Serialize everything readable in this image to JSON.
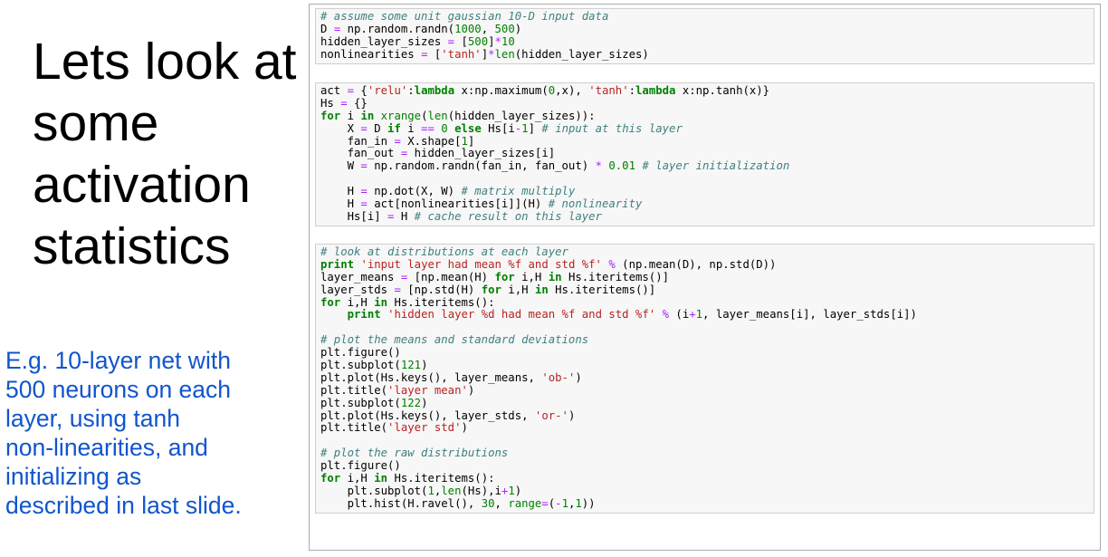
{
  "slide": {
    "title_lines": [
      "Lets look at",
      "some",
      "activation",
      "statistics"
    ],
    "caption_lines": [
      "E.g. 10-layer net with",
      "500 neurons on each",
      "layer, using tanh",
      "non-linearities, and",
      "initializing as",
      "described in last slide."
    ]
  },
  "cells": [
    {
      "lines": [
        "# assume some unit gaussian 10-D input data",
        "D = np.random.randn(1000, 500)",
        "hidden_layer_sizes = [500]*10",
        "nonlinearities = ['tanh']*len(hidden_layer_sizes)"
      ]
    },
    {
      "lines": [
        "act = {'relu':lambda x:np.maximum(0,x), 'tanh':lambda x:np.tanh(x)}",
        "Hs = {}",
        "for i in xrange(len(hidden_layer_sizes)):",
        "    X = D if i == 0 else Hs[i-1] # input at this layer",
        "    fan_in = X.shape[1]",
        "    fan_out = hidden_layer_sizes[i]",
        "    W = np.random.randn(fan_in, fan_out) * 0.01 # layer initialization",
        "",
        "    H = np.dot(X, W) # matrix multiply",
        "    H = act[nonlinearities[i]](H) # nonlinearity",
        "    Hs[i] = H # cache result on this layer"
      ]
    },
    {
      "lines": [
        "# look at distributions at each layer",
        "print 'input layer had mean %f and std %f' % (np.mean(D), np.std(D))",
        "layer_means = [np.mean(H) for i,H in Hs.iteritems()]",
        "layer_stds = [np.std(H) for i,H in Hs.iteritems()]",
        "for i,H in Hs.iteritems():",
        "    print 'hidden layer %d had mean %f and std %f' % (i+1, layer_means[i], layer_stds[i])",
        "",
        "# plot the means and standard deviations",
        "plt.figure()",
        "plt.subplot(121)",
        "plt.plot(Hs.keys(), layer_means, 'ob-')",
        "plt.title('layer mean')",
        "plt.subplot(122)",
        "plt.plot(Hs.keys(), layer_stds, 'or-')",
        "plt.title('layer std')",
        "",
        "# plot the raw distributions",
        "plt.figure()",
        "for i,H in Hs.iteritems():",
        "    plt.subplot(1,len(Hs),i+1)",
        "    plt.hist(H.ravel(), 30, range=(-1,1))"
      ]
    }
  ],
  "colors": {
    "caption": "#1155cc",
    "comment": "#408080",
    "keyword": "#008000",
    "string": "#ba2121",
    "number": "#008000",
    "operator": "#aa22ff",
    "cell_background": "#f7f7f7"
  }
}
